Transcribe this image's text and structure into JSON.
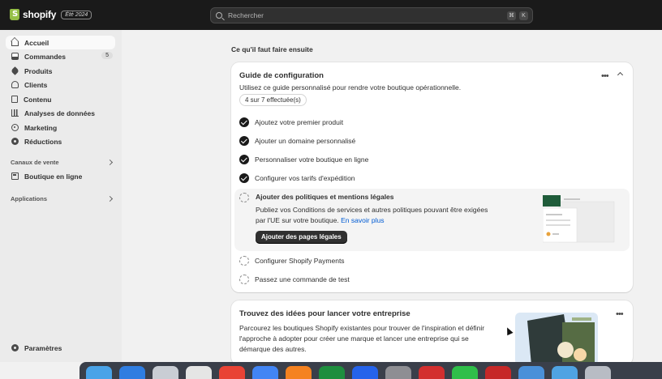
{
  "header": {
    "logo_text": "shopify",
    "edition": "Été 2024",
    "search_placeholder": "Rechercher",
    "shortcut_keys": [
      "⌘",
      "K"
    ]
  },
  "sidebar": {
    "items": [
      {
        "label": "Accueil",
        "icon": "home-icon",
        "active": true
      },
      {
        "label": "Commandes",
        "icon": "orders-icon",
        "badge": "5"
      },
      {
        "label": "Produits",
        "icon": "tag-icon"
      },
      {
        "label": "Clients",
        "icon": "person-icon"
      },
      {
        "label": "Contenu",
        "icon": "content-icon"
      },
      {
        "label": "Analyses de données",
        "icon": "analytics-icon"
      },
      {
        "label": "Marketing",
        "icon": "target-icon"
      },
      {
        "label": "Réductions",
        "icon": "discount-icon"
      }
    ],
    "sales_channels_title": "Canaux de vente",
    "sales_channels": [
      {
        "label": "Boutique en ligne",
        "icon": "store-icon"
      }
    ],
    "apps_title": "Applications",
    "settings_label": "Paramètres"
  },
  "main": {
    "section_title": "Ce qu'il faut faire ensuite",
    "setup_guide": {
      "title": "Guide de configuration",
      "subtitle": "Utilisez ce guide personnalisé pour rendre votre boutique opérationnelle.",
      "progress": "4 sur 7 effectuée(s)",
      "progress_done": 4,
      "progress_total": 7,
      "tasks": [
        {
          "label": "Ajoutez votre premier produit",
          "done": true
        },
        {
          "label": "Ajouter un domaine personnalisé",
          "done": true
        },
        {
          "label": "Personnaliser votre boutique en ligne",
          "done": true
        },
        {
          "label": "Configurer vos tarifs d'expédition",
          "done": true
        },
        {
          "label": "Configurer Shopify Payments",
          "done": false
        },
        {
          "label": "Passez une commande de test",
          "done": false
        }
      ],
      "expanded_task": {
        "title": "Ajouter des politiques et mentions légales",
        "description": "Publiez vos Conditions de services et autres politiques pouvant être exigées par l'UE sur votre boutique.",
        "link": "En savoir plus",
        "button": "Ajouter des pages légales"
      }
    },
    "ideas_card": {
      "title": "Trouvez des idées pour lancer votre entreprise",
      "description": "Parcourez les boutiques Shopify existantes pour trouver de l'inspiration et définir l'approche à adopter pour créer une marque et lancer une entreprise qui se démarque des autres."
    }
  },
  "dock": {
    "apps": [
      "finder-icon",
      "safari-icon",
      "launchpad-icon",
      "slack-icon",
      "chrome-icon",
      "docs-icon",
      "sublime-icon",
      "sheets-icon",
      "app-icon",
      "system-settings-icon",
      "app-red-icon",
      "facetime-icon",
      "acrobat-icon",
      "app-blue-icon",
      "folder-icon",
      "trash-icon"
    ],
    "colors": [
      "#4aa3e8",
      "#2f7de1",
      "#c9cdd4",
      "#e5e5e5",
      "#e94335",
      "#4285f4",
      "#f58220",
      "#1e8e3e",
      "#2563eb",
      "#8e8e93",
      "#d32f2f",
      "#2fbf4a",
      "#c62828",
      "#4a90d9",
      "#4fa3e3",
      "#b8bcc4"
    ]
  }
}
